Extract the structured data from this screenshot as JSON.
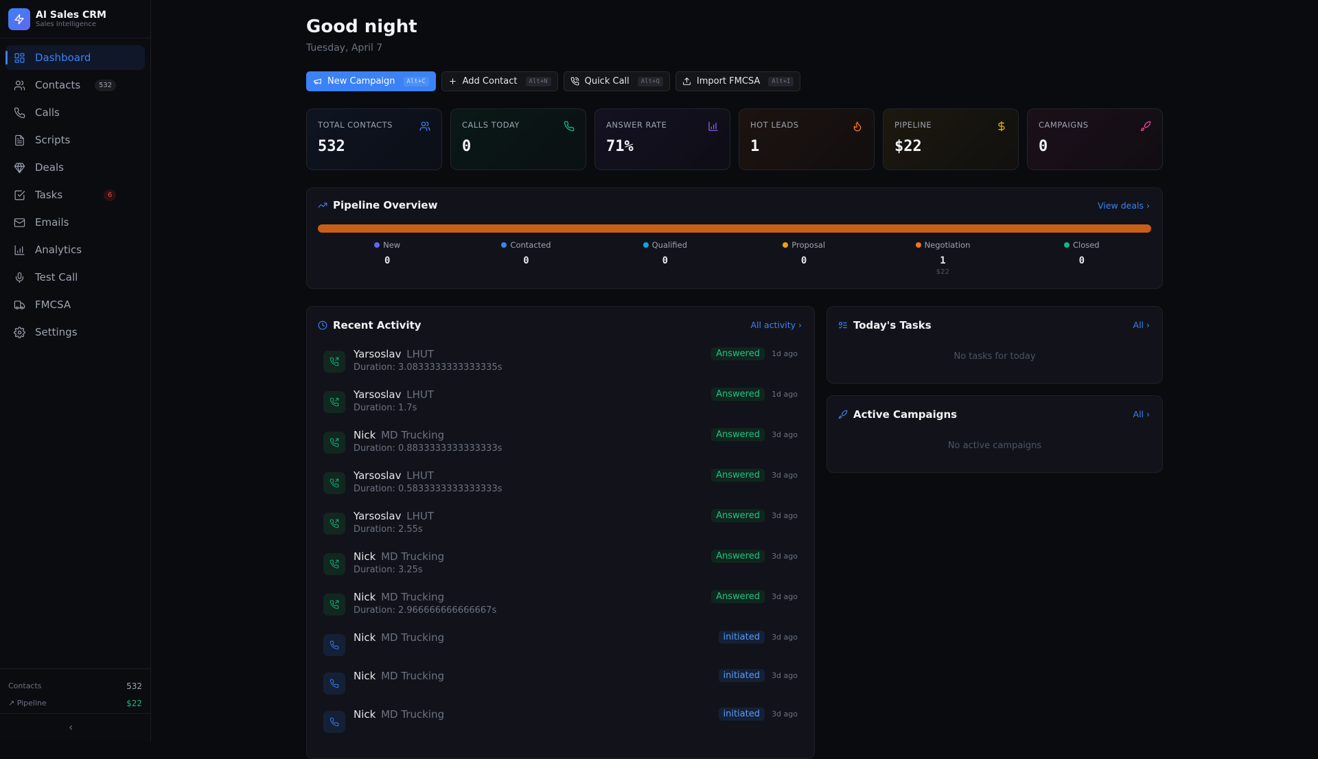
{
  "brand": {
    "name": "AI Sales CRM",
    "tagline": "Sales Intelligence"
  },
  "nav": [
    {
      "label": "Dashboard",
      "icon": "layout-dashboard-icon",
      "active": true
    },
    {
      "label": "Contacts",
      "icon": "users-icon",
      "badge": "532"
    },
    {
      "label": "Calls",
      "icon": "phone-icon"
    },
    {
      "label": "Scripts",
      "icon": "file-text-icon"
    },
    {
      "label": "Deals",
      "icon": "gem-icon"
    },
    {
      "label": "Tasks",
      "icon": "check-square-icon",
      "badge": "6"
    },
    {
      "label": "Emails",
      "icon": "mail-icon"
    },
    {
      "label": "Analytics",
      "icon": "bar-chart-icon"
    },
    {
      "label": "Test Call",
      "icon": "mic-icon"
    },
    {
      "label": "FMCSA",
      "icon": "truck-icon"
    },
    {
      "label": "Settings",
      "icon": "settings-icon"
    }
  ],
  "sidebar_footer": {
    "contacts_label": "Contacts",
    "contacts_value": "532",
    "pipeline_label": "Pipeline",
    "pipeline_value": "$22"
  },
  "header": {
    "greeting": "Good night",
    "date": "Tuesday, April 7"
  },
  "actions": [
    {
      "label": "New Campaign",
      "shortcut": "Alt+C"
    },
    {
      "label": "Add Contact",
      "shortcut": "Alt+N"
    },
    {
      "label": "Quick Call",
      "shortcut": "Alt+Q"
    },
    {
      "label": "Import FMCSA",
      "shortcut": "Alt+I"
    }
  ],
  "stats": [
    {
      "label": "TOTAL CONTACTS",
      "value": "532",
      "color": "#3b82f6"
    },
    {
      "label": "CALLS TODAY",
      "value": "0",
      "color": "#10b981"
    },
    {
      "label": "ANSWER RATE",
      "value": "71%",
      "color": "#8b5cf6"
    },
    {
      "label": "HOT LEADS",
      "value": "1",
      "color": "#f97316"
    },
    {
      "label": "PIPELINE",
      "value": "$22",
      "color": "#eab308"
    },
    {
      "label": "CAMPAIGNS",
      "value": "0",
      "color": "#ec4899"
    }
  ],
  "pipeline": {
    "title": "Pipeline Overview",
    "link": "View deals",
    "stages": [
      {
        "label": "New",
        "count": "0",
        "color": "#6366f1"
      },
      {
        "label": "Contacted",
        "count": "0",
        "color": "#3b82f6"
      },
      {
        "label": "Qualified",
        "count": "0",
        "color": "#0ea5e9"
      },
      {
        "label": "Proposal",
        "count": "0",
        "color": "#f59e0b"
      },
      {
        "label": "Negotiation",
        "count": "1",
        "amount": "$22",
        "color": "#f97316"
      },
      {
        "label": "Closed",
        "count": "0",
        "color": "#10b981"
      }
    ]
  },
  "activity": {
    "title": "Recent Activity",
    "link": "All activity",
    "items": [
      {
        "name": "Yarsoslav",
        "company": "LHUT",
        "duration": "Duration: 3.0833333333333335s",
        "status": "Answered",
        "ago": "1d ago"
      },
      {
        "name": "Yarsoslav",
        "company": "LHUT",
        "duration": "Duration: 1.7s",
        "status": "Answered",
        "ago": "1d ago"
      },
      {
        "name": "Nick",
        "company": "MD Trucking",
        "duration": "Duration: 0.8833333333333333s",
        "status": "Answered",
        "ago": "3d ago"
      },
      {
        "name": "Yarsoslav",
        "company": "LHUT",
        "duration": "Duration: 0.5833333333333333s",
        "status": "Answered",
        "ago": "3d ago"
      },
      {
        "name": "Yarsoslav",
        "company": "LHUT",
        "duration": "Duration: 2.55s",
        "status": "Answered",
        "ago": "3d ago"
      },
      {
        "name": "Nick",
        "company": "MD Trucking",
        "duration": "Duration: 3.25s",
        "status": "Answered",
        "ago": "3d ago"
      },
      {
        "name": "Nick",
        "company": "MD Trucking",
        "duration": "Duration: 2.966666666666667s",
        "status": "Answered",
        "ago": "3d ago"
      },
      {
        "name": "Nick",
        "company": "MD Trucking",
        "status": "initiated",
        "ago": "3d ago"
      },
      {
        "name": "Nick",
        "company": "MD Trucking",
        "status": "initiated",
        "ago": "3d ago"
      },
      {
        "name": "Nick",
        "company": "MD Trucking",
        "status": "initiated",
        "ago": "3d ago"
      }
    ]
  },
  "tasks": {
    "title": "Today's Tasks",
    "link": "All",
    "empty": "No tasks for today"
  },
  "campaigns": {
    "title": "Active Campaigns",
    "link": "All",
    "empty": "No active campaigns"
  }
}
